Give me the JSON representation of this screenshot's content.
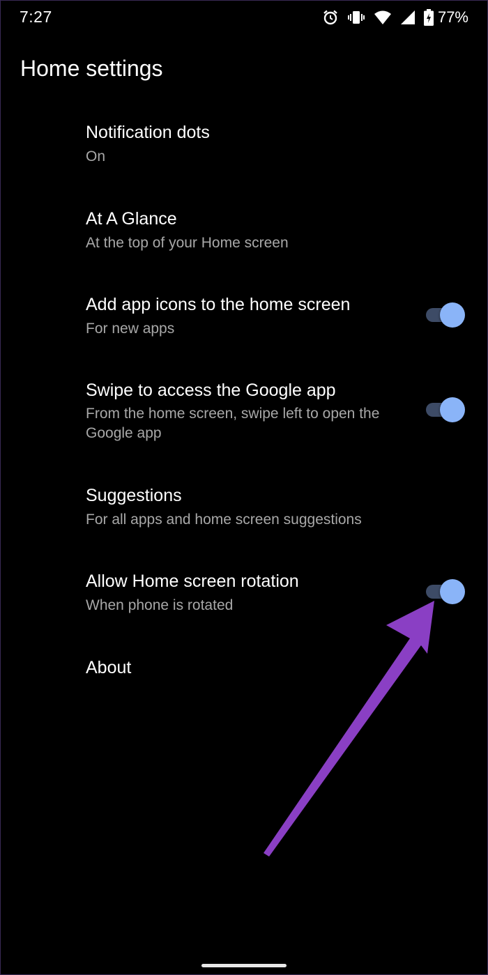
{
  "status_bar": {
    "time": "7:27",
    "battery": "77%",
    "icons": [
      "alarm-icon",
      "vibrate-icon",
      "wifi-icon",
      "signal-icon",
      "battery-charging-icon"
    ]
  },
  "header": {
    "title": "Home settings"
  },
  "settings": [
    {
      "title": "Notification dots",
      "subtitle": "On"
    },
    {
      "title": "At A Glance",
      "subtitle": "At the top of your Home screen"
    },
    {
      "title": "Add app icons to the home screen",
      "subtitle": "For new apps",
      "toggle": true,
      "on": true
    },
    {
      "title": "Swipe to access the Google app",
      "subtitle": "From the home screen, swipe left to open the Google app",
      "toggle": true,
      "on": true
    },
    {
      "title": "Suggestions",
      "subtitle": "For all apps and home screen suggestions"
    },
    {
      "title": "Allow Home screen rotation",
      "subtitle": "When phone is rotated",
      "toggle": true,
      "on": true
    },
    {
      "title": "About"
    }
  ],
  "colors": {
    "background": "#000000",
    "toggle_thumb": "#8ab4f8",
    "toggle_track": "#3d4b66",
    "subtitle": "#a8a8a8",
    "annotation_arrow": "#8a3fc4"
  }
}
